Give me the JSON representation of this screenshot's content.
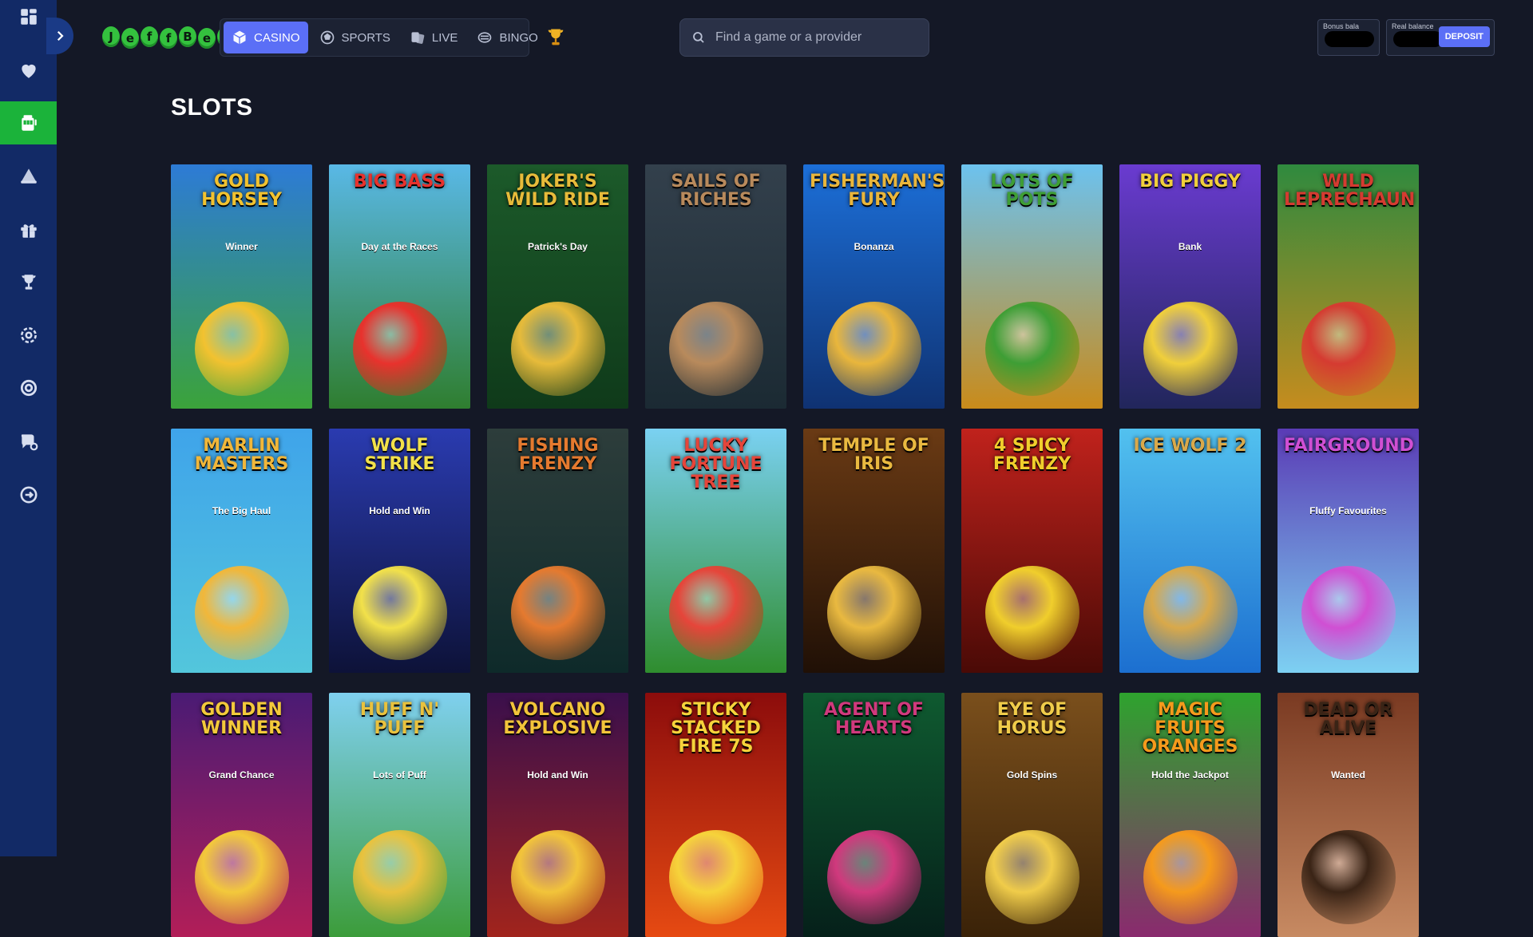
{
  "brand": {
    "logo_letters": [
      "J",
      "e",
      "f",
      "f",
      "B",
      "e",
      "T"
    ]
  },
  "nav": {
    "tabs": [
      {
        "label": "CASINO",
        "icon": "cube-icon",
        "active": true
      },
      {
        "label": "SPORTS",
        "icon": "football-icon",
        "active": false
      },
      {
        "label": "LIVE",
        "icon": "cards-icon",
        "active": false
      },
      {
        "label": "BINGO",
        "icon": "bingo-icon",
        "active": false
      }
    ]
  },
  "search": {
    "placeholder": "Find a game or a provider"
  },
  "balances": {
    "bonus_label": "Bonus bala",
    "real_label": "Real balance",
    "deposit_label": "DEPOSIT"
  },
  "sidebar": {
    "items": [
      "grid-icon",
      "heart-icon",
      "slots-icon",
      "table-games-icon",
      "gift-icon",
      "trophy-icon",
      "settings-icon",
      "lifebuoy-icon",
      "chat-support-icon",
      "logout-icon"
    ]
  },
  "page": {
    "title": "SLOTS"
  },
  "games": [
    {
      "title": "Gold Horsey",
      "sub": "Winner",
      "c1": "#2d7bd6",
      "c2": "#3ba33a",
      "accent": "#f2c230"
    },
    {
      "title": "Big Bass",
      "sub": "Day at the Races",
      "c1": "#59b8e6",
      "c2": "#2f7e2f",
      "accent": "#e8322d"
    },
    {
      "title": "Joker's Wild Ride",
      "sub": "Patrick's Day",
      "c1": "#1c5a2a",
      "c2": "#0f3a1a",
      "accent": "#e7bb3a"
    },
    {
      "title": "Sails of Riches",
      "sub": "",
      "c1": "#33404c",
      "c2": "#1b2a33",
      "accent": "#b88a5c"
    },
    {
      "title": "Fisherman's Fury",
      "sub": "Bonanza",
      "c1": "#1c6fd8",
      "c2": "#0f3272",
      "accent": "#e9b63c"
    },
    {
      "title": "Lots of Pots",
      "sub": "",
      "c1": "#6cc2ef",
      "c2": "#c98b1a",
      "accent": "#3e9e35"
    },
    {
      "title": "Big Piggy",
      "sub": "Bank",
      "c1": "#6a3bd0",
      "c2": "#21265b",
      "accent": "#f0cf3b"
    },
    {
      "title": "Wild Leprechaun",
      "sub": "",
      "c1": "#2f8a3e",
      "c2": "#c58c1e",
      "accent": "#d53b31"
    },
    {
      "title": "Marlin Masters",
      "sub": "The Big Haul",
      "c1": "#3fa4ea",
      "c2": "#53c6dc",
      "accent": "#f1b73a"
    },
    {
      "title": "Wolf Strike",
      "sub": "Hold and Win",
      "c1": "#2a3bb0",
      "c2": "#0d1238",
      "accent": "#f2e14a"
    },
    {
      "title": "Fishing Frenzy",
      "sub": "",
      "c1": "#2d3d3b",
      "c2": "#0e2a2a",
      "accent": "#e57a2f"
    },
    {
      "title": "Lucky Fortune Tree",
      "sub": "",
      "c1": "#7ad1f2",
      "c2": "#2f8d2e",
      "accent": "#e6453a"
    },
    {
      "title": "Temple of Iris",
      "sub": "",
      "c1": "#6a3a14",
      "c2": "#201006",
      "accent": "#e9b940"
    },
    {
      "title": "4 Spicy Frenzy",
      "sub": "",
      "c1": "#c0221c",
      "c2": "#4a0a06",
      "accent": "#f0ce2c"
    },
    {
      "title": "Ice Wolf 2",
      "sub": "",
      "c1": "#52c1ef",
      "c2": "#1c6fd0",
      "accent": "#d9a94a"
    },
    {
      "title": "Fairground",
      "sub": "Fluffy Favourites",
      "c1": "#5a3bb5",
      "c2": "#7dd0f2",
      "accent": "#d04fd3"
    },
    {
      "title": "Golden Winner",
      "sub": "Grand Chance",
      "c1": "#4a1b74",
      "c2": "#b21e58",
      "accent": "#f3c93b"
    },
    {
      "title": "Huff n' Puff",
      "sub": "Lots of Puff",
      "c1": "#7fd0ef",
      "c2": "#3c9c3a",
      "accent": "#e9c23e"
    },
    {
      "title": "Volcano Explosive",
      "sub": "Hold and Win",
      "c1": "#3a0f4c",
      "c2": "#a1241c",
      "accent": "#f2c43a"
    },
    {
      "title": "Sticky Stacked Fire 7s",
      "sub": "",
      "c1": "#8c0c0c",
      "c2": "#e64a12",
      "accent": "#f6d33b"
    },
    {
      "title": "Agent of Hearts",
      "sub": "",
      "c1": "#0f5a30",
      "c2": "#05201a",
      "accent": "#d0397d"
    },
    {
      "title": "Eye of Horus",
      "sub": "Gold Spins",
      "c1": "#7a4f1c",
      "c2": "#3a2208",
      "accent": "#f0cc4a"
    },
    {
      "title": "Magic Fruits Oranges",
      "sub": "Hold the Jackpot",
      "c1": "#2ea32e",
      "c2": "#8a2a6e",
      "accent": "#f59a1c"
    },
    {
      "title": "Dead or Alive",
      "sub": "Wanted",
      "c1": "#7a3a22",
      "c2": "#c78a62",
      "accent": "#3a2416"
    }
  ]
}
